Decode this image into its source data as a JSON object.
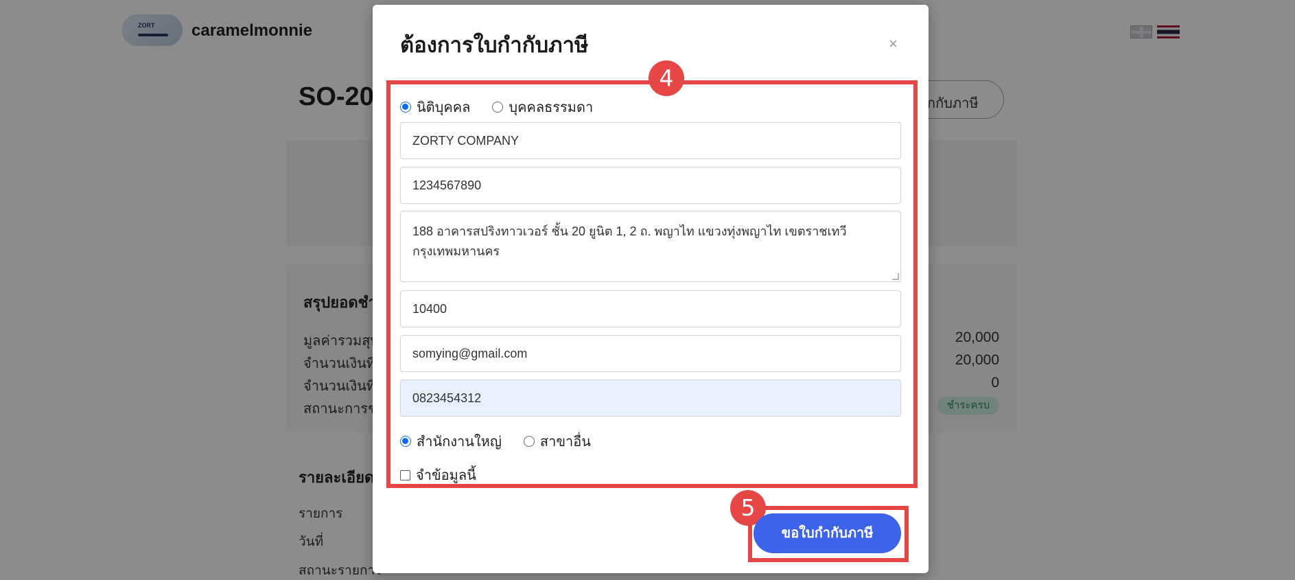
{
  "header": {
    "shop_name": "caramelmonnie",
    "logo_text": "ZORT"
  },
  "page": {
    "order_no": "SO-20",
    "request_tax_button": "กกับภาษี",
    "summary": {
      "title": "สรุปยอดชำ",
      "rows": [
        {
          "label": "มูลค่ารวมสุทธิ",
          "value": "20,000"
        },
        {
          "label": "จำนวนเงินที่ชำ",
          "value": "20,000"
        },
        {
          "label": "จำนวนเงินที่ชำ",
          "value": "0"
        },
        {
          "label": "สถานะการชำ",
          "value": ""
        }
      ],
      "status_badge": "ชำระครบ"
    },
    "details": {
      "title": "รายละเอียด",
      "rows": [
        "รายการ",
        "วันที่",
        "สถานะรายการ"
      ]
    }
  },
  "modal": {
    "title": "ต้องการใบกำกับภาษี",
    "close_label": "×",
    "entity_type": {
      "options": [
        "นิติบุคคล",
        "บุคคลธรรมดา"
      ],
      "selected": "นิติบุคคล"
    },
    "fields": {
      "company_name": "ZORTY COMPANY",
      "tax_id": "1234567890",
      "address": "188 อาคารสปริงทาวเวอร์ ชั้น 20 ยูนิต 1, 2 ถ. พญาไท แขวงทุ่งพญาไท เขตราชเทวี กรุงเทพมหานคร",
      "postcode": "10400",
      "email": "somying@gmail.com",
      "phone": "0823454312"
    },
    "branch": {
      "options": [
        "สำนักงานใหญ่",
        "สาขาอื่น"
      ],
      "selected": "สำนักงานใหญ่"
    },
    "remember_label": "จำข้อมูลนี้",
    "submit_label": "ขอใบกำกับภาษี",
    "steps": {
      "form": "4",
      "submit": "5"
    }
  }
}
